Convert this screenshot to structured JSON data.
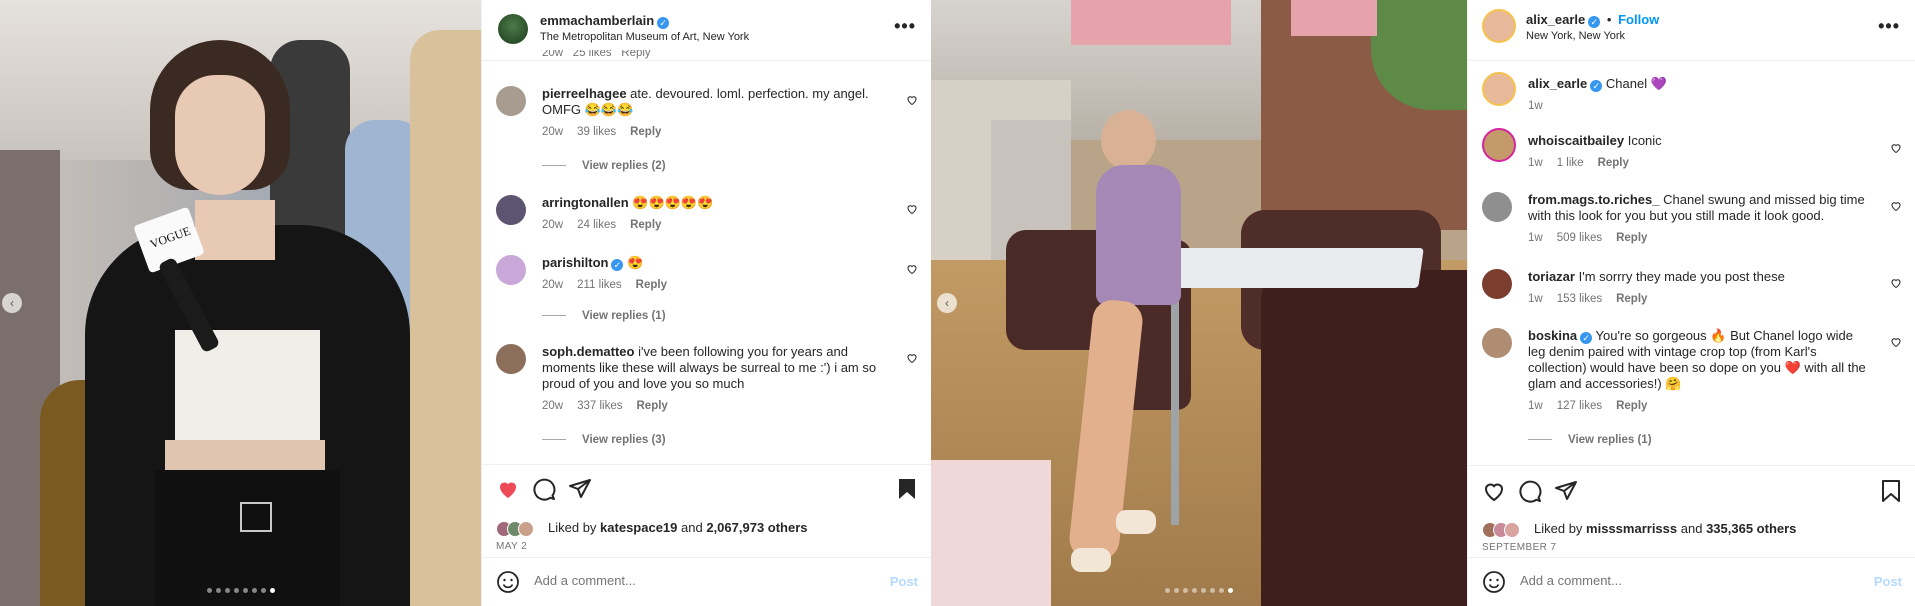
{
  "colors": {
    "like_red": "#ed4956",
    "verified_blue": "#3797f0",
    "follow_blue": "#0095f6",
    "muted": "#737373"
  },
  "icons": [
    "more-icon",
    "heart-icon",
    "comment-icon",
    "share-icon",
    "bookmark-icon",
    "emoji-icon",
    "verified-icon"
  ],
  "post1": {
    "username": "emmachamberlain",
    "location": "The Metropolitan Museum of Art, New York",
    "more": "•••",
    "partial_meta": "20w   25 likes   Reply",
    "comments": [
      {
        "user": "pierreelhagee",
        "text": "ate. devoured. loml. perfection. my angel. OMFG 😂😂😂",
        "age": "20w",
        "likes": "39 likes",
        "reply": "Reply",
        "view_replies": "View replies (2)"
      },
      {
        "user": "arringtonallen",
        "text": "😍😍😍😍😍",
        "age": "20w",
        "likes": "24 likes",
        "reply": "Reply"
      },
      {
        "user": "parishilton",
        "text": "😍",
        "age": "20w",
        "likes": "211 likes",
        "reply": "Reply",
        "view_replies": "View replies (1)"
      },
      {
        "user": "soph.dematteo",
        "text": "i've been following you for years and moments like these will always be surreal to me :') i am so proud of you and love you so much",
        "age": "20w",
        "likes": "337 likes",
        "reply": "Reply",
        "view_replies": "View replies (3)"
      }
    ],
    "liked_by_prefix": "Liked by",
    "liked_by_user": "katespace19",
    "liked_by_and": "and",
    "liked_by_count": "2,067,973 others",
    "date": "MAY 2",
    "add_comment_placeholder": "Add a comment...",
    "post_label": "Post",
    "photo_microphone_text": "VOGUE"
  },
  "post2": {
    "username": "alix_earle",
    "follow_sep": "•",
    "follow_label": "Follow",
    "location": "New York, New York",
    "more": "•••",
    "caption": {
      "user": "alix_earle",
      "text": "Chanel 💜",
      "age": "1w"
    },
    "comments": [
      {
        "user": "whoiscaitbailey",
        "text": "Iconic",
        "age": "1w",
        "likes": "1 like",
        "reply": "Reply"
      },
      {
        "user": "from.mags.to.riches_",
        "text": "Chanel swung and missed big time with this look for you but you still made it look good.",
        "age": "1w",
        "likes": "509 likes",
        "reply": "Reply"
      },
      {
        "user": "toriazar",
        "text": "I'm sorrry they made you post these",
        "age": "1w",
        "likes": "153 likes",
        "reply": "Reply"
      },
      {
        "user": "boskina",
        "text": "You're so gorgeous 🔥 But Chanel logo wide leg denim paired with vintage crop top (from Karl's collection) would have been so dope on you ❤️ with all the glam and accessories!) 🤗",
        "age": "1w",
        "likes": "127 likes",
        "reply": "Reply",
        "view_replies": "View replies (1)"
      }
    ],
    "liked_by_prefix": "Liked by",
    "liked_by_user": "misssmarrisss",
    "liked_by_and": "and",
    "liked_by_count": "335,365 others",
    "date": "SEPTEMBER 7",
    "add_comment_placeholder": "Add a comment...",
    "post_label": "Post"
  }
}
